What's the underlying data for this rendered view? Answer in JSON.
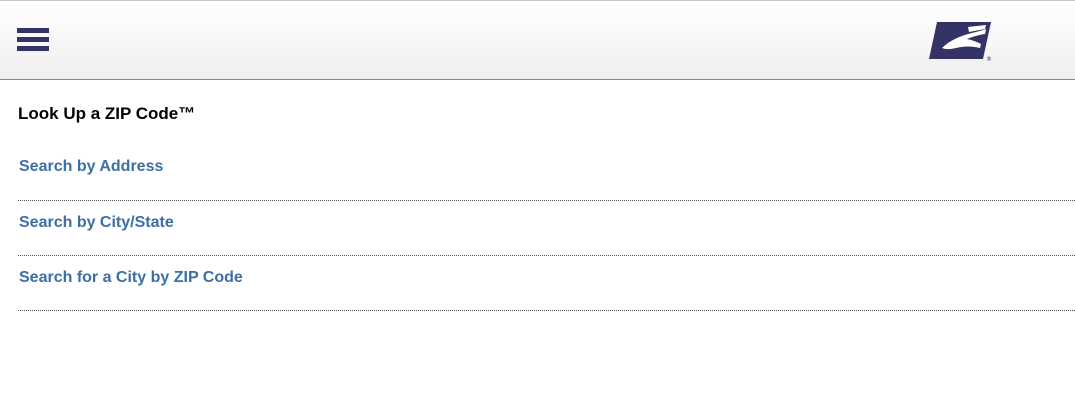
{
  "header": {
    "menu_icon": "hamburger-menu-icon",
    "logo_icon": "usps-eagle-logo-icon",
    "logo_trademark": "®",
    "colors": {
      "brand_navy": "#333366",
      "link_blue": "#3d6ea6"
    }
  },
  "main": {
    "title": "Look Up a ZIP Code™",
    "links": [
      {
        "label": "Search by Address"
      },
      {
        "label": "Search by City/State"
      },
      {
        "label": "Search for a City by ZIP Code"
      }
    ]
  }
}
